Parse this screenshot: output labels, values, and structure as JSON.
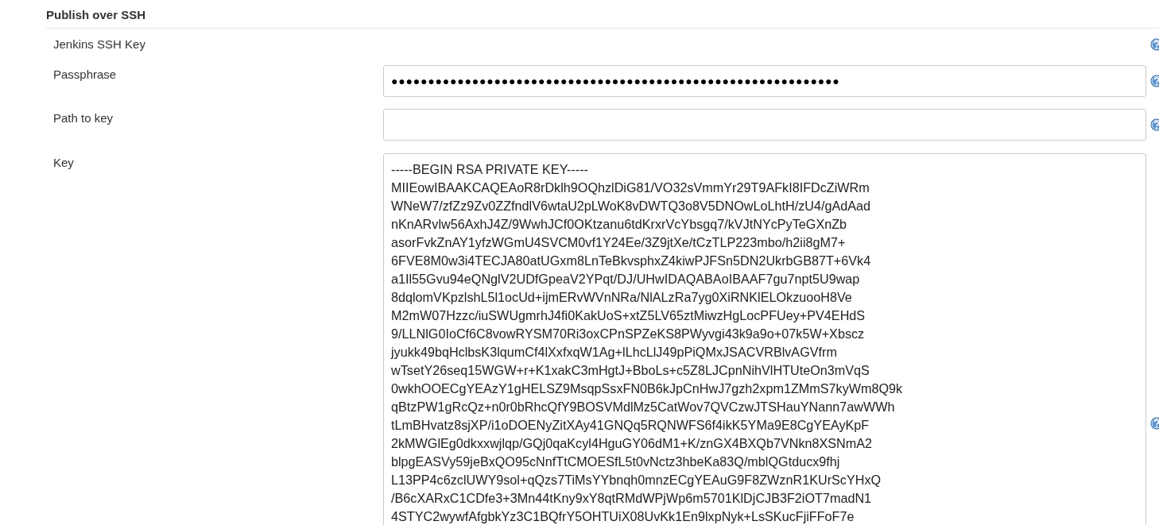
{
  "section": {
    "title": "Publish over SSH"
  },
  "fields": [
    {
      "kind": "heading",
      "label": "Jenkins SSH Key",
      "help": true
    },
    {
      "kind": "password",
      "label": "Passphrase",
      "value": "●●●●●●●●●●●●●●●●●●●●●●●●●●●●●●●●●●●●●●●●●●●●●●●●●●●●●●●●●●●●●",
      "help": true
    },
    {
      "kind": "text",
      "label": "Path to key",
      "help": true
    },
    {
      "kind": "textarea",
      "label": "Key",
      "help": true,
      "lines": [
        "-----BEGIN RSA PRIVATE KEY-----",
        "MIIEowIBAAKCAQEAoR8rDklh9OQhzlDiG81/VO32sVmmYr29T9AFkI8IFDcZiWRm",
        "WNeW7/zfZz9Zv0ZZfndlV6wtaU2pLWoK8vDWTQ3o8V5DNOwLoLhtH/zU4/gAdAad",
        "nKnARvlw56AxhJ4Z/9WwhJCf0OKtzanu6tdKrxrVcYbsgq7/kVJtNYcPyTeGXnZb",
        "asorFvkZnAY1yfzWGmU4SVCM0vf1Y24Ee/3Z9jtXe/tCzTLP223mbo/h2ii8gM7+",
        "6FVE8M0w3i4TECJA80atUGxm8LnTeBkvsphxZ4kiwPJFSn5DN2UkrbGB87T+6Vk4",
        "a1Il55Gvu94eQNglV2UDfGpeaV2YPqt/DJ/UHwIDAQABAoIBAAF7gu7npt5U9wap",
        "8dqlomVKpzlshL5l1ocUd+ijmERvWVnNRa/NlALzRa7yg0XiRNKlELOkzuooH8Ve",
        "M2mW07Hzzc/iuSWUgmrhJ4fi0KakUoS+xtZ5LV65ztMiwzHgLocPFUey+PV4EHdS",
        "9/LLNlG0IoCf6C8vowRYSM70Ri3oxCPnSPZeKS8PWyvgi43k9a9o+07k5W+Xbscz",
        "jyukk49bqHclbsK3lqumCf4lXxfxqW1Ag+lLhcLlJ49pPiQMxJSACVRBlvAGVfrm",
        "wTsetY26seq15WGW+r+K1xakC3mHgtJ+BboLs+c5Z8LJCpnNihVlHTUteOn3mVqS",
        "0wkhOOECgYEAzY1gHELSZ9MsqpSsxFN0B6kJpCnHwJ7gzh2xpm1ZMmS7kyWm8Q9k",
        "qBtzPW1gRcQz+n0r0bRhcQfY9BOSVMdlMz5CatWov7QVCzwJTSHauYNann7awWWh",
        "tLmBHvatz8sjXP/i1oDOENyZitXAy41GNQq5RQNWFS6f4ikK5YMa9E8CgYEAyKpF",
        "2kMWGlEg0dkxxwjlqp/GQj0qaKcyl4HguGY06dM1+K/znGX4BXQb7VNkn8XSNmA2",
        "blpgEASVy59jeBxQO95cNnfTtCMOESfL5t0vNctz3hbeKa83Q/mblQGtducx9fhj",
        "L13PP4c6zclUWY9sol+qQzs7TiMsYYbnqh0mnzECgYEAuG9F8ZWznR1KUrScYHxQ",
        "/B6cXARxC1CDfe3+3Mn44tKny9xY8qtRMdWPjWp6m5701KlDjCJB3F2iOT7madN1",
        "4STYC2wywfAfgbkYz3C1BQfrY5OHTUiX08UvKk1En9lxpNyk+LsSKucFjiFFoF7e"
      ]
    }
  ]
}
